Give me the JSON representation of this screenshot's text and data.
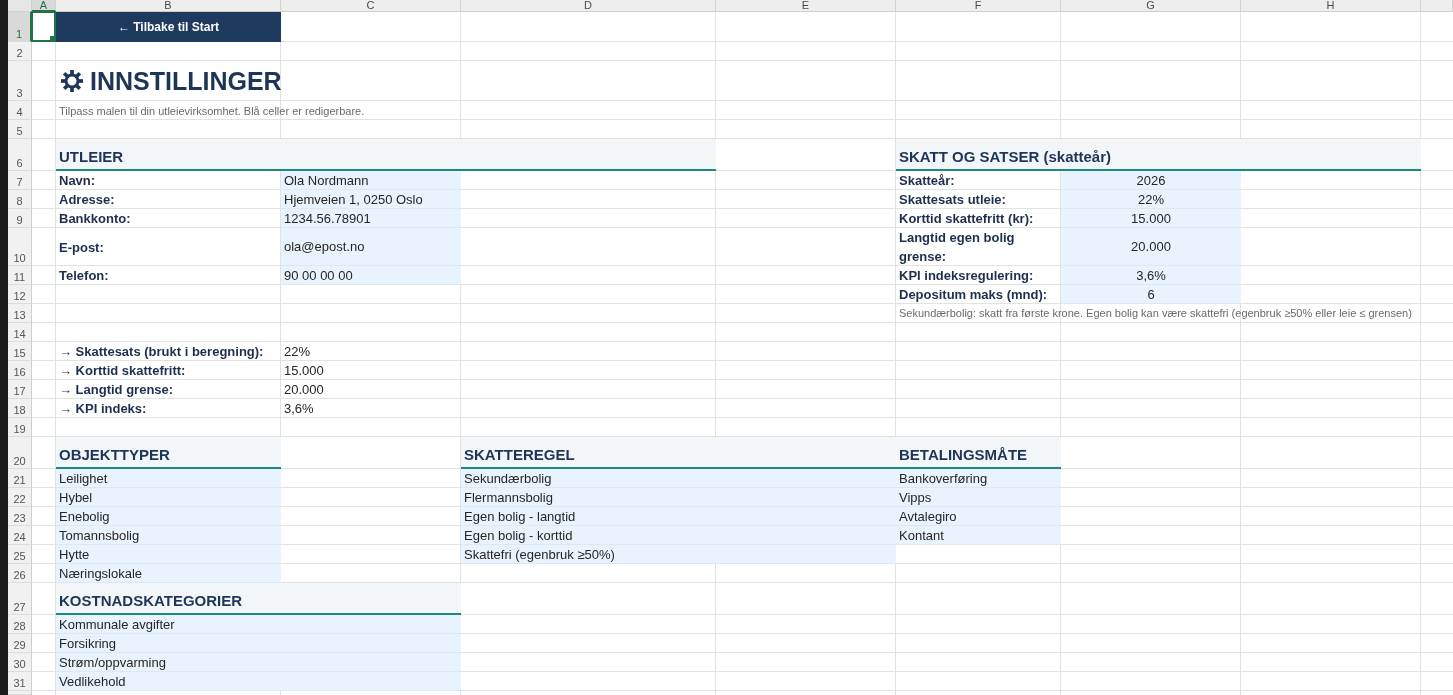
{
  "columns": [
    {
      "label": "A",
      "selected": true
    },
    {
      "label": "B",
      "selected": false
    },
    {
      "label": "C",
      "selected": false
    },
    {
      "label": "D",
      "selected": false
    },
    {
      "label": "E",
      "selected": false
    },
    {
      "label": "F",
      "selected": false
    },
    {
      "label": "G",
      "selected": false
    },
    {
      "label": "H",
      "selected": false
    }
  ],
  "rows": [
    {
      "label": "1",
      "selected": true
    },
    {
      "label": "2",
      "selected": false
    },
    {
      "label": "3",
      "selected": false
    },
    {
      "label": "4",
      "selected": false
    },
    {
      "label": "5",
      "selected": false
    },
    {
      "label": "6",
      "selected": false
    },
    {
      "label": "7",
      "selected": false
    },
    {
      "label": "8",
      "selected": false
    },
    {
      "label": "9",
      "selected": false
    },
    {
      "label": "10",
      "selected": false
    },
    {
      "label": "11",
      "selected": false
    },
    {
      "label": "12",
      "selected": false
    },
    {
      "label": "13",
      "selected": false
    },
    {
      "label": "14",
      "selected": false
    },
    {
      "label": "15",
      "selected": false
    },
    {
      "label": "16",
      "selected": false
    },
    {
      "label": "17",
      "selected": false
    },
    {
      "label": "18",
      "selected": false
    },
    {
      "label": "19",
      "selected": false
    },
    {
      "label": "20",
      "selected": false
    },
    {
      "label": "21",
      "selected": false
    },
    {
      "label": "22",
      "selected": false
    },
    {
      "label": "23",
      "selected": false
    },
    {
      "label": "24",
      "selected": false
    },
    {
      "label": "25",
      "selected": false
    },
    {
      "label": "26",
      "selected": false
    },
    {
      "label": "27",
      "selected": false
    },
    {
      "label": "28",
      "selected": false
    },
    {
      "label": "29",
      "selected": false
    },
    {
      "label": "30",
      "selected": false
    },
    {
      "label": "31",
      "selected": false
    }
  ],
  "back_button": {
    "label": "← Tilbake til Start"
  },
  "title": "INNSTILLINGER",
  "subtitle": "Tilpass malen til din utleievirksomhet. Blå celler er redigerbare.",
  "landlord": {
    "heading": "UTLEIER",
    "fields": [
      {
        "label": "Navn:",
        "value": "Ola Nordmann"
      },
      {
        "label": "Adresse:",
        "value": "Hjemveien 1, 0250 Oslo"
      },
      {
        "label": "Bankkonto:",
        "value": "1234.56.78901"
      },
      {
        "label": "E-post:",
        "value": "ola@epost.no"
      },
      {
        "label": "Telefon:",
        "value": "90 00 00 00"
      }
    ]
  },
  "tax": {
    "heading": "SKATT OG SATSER (skatteår)",
    "fields": [
      {
        "label": "Skatteår:",
        "value": "2026"
      },
      {
        "label": "Skattesats utleie:",
        "value": "22%"
      },
      {
        "label": "Korttid skattefritt (kr):",
        "value": "15.000"
      },
      {
        "label": "Langtid egen bolig grense:",
        "value": "20.000"
      },
      {
        "label": "KPI indeksregulering:",
        "value": "3,6%"
      },
      {
        "label": "Depositum maks (mnd):",
        "value": "6"
      }
    ],
    "note": "Sekundærbolig: skatt fra første krone. Egen bolig kan være skattefri (egenbruk ≥50% eller leie ≤ grensen)"
  },
  "derived": [
    {
      "label": "→ Skattesats (brukt i beregning):",
      "value": "22%"
    },
    {
      "label": "→ Korttid skattefritt:",
      "value": "15.000"
    },
    {
      "label": "→ Langtid grense:",
      "value": "20.000"
    },
    {
      "label": "→ KPI indeks:",
      "value": "3,6%"
    }
  ],
  "lists": [
    {
      "heading": "OBJEKTTYPER",
      "items": [
        "Leilighet",
        "Hybel",
        "Enebolig",
        "Tomannsbolig",
        "Hytte",
        "Næringslokale"
      ]
    },
    {
      "heading": "SKATTEREGEL",
      "items": [
        "Sekundærbolig",
        "Flermannsbolig",
        "Egen bolig - langtid",
        "Egen bolig - korttid",
        "Skattefri (egenbruk ≥50%)"
      ]
    },
    {
      "heading": "BETALINGSMÅTE",
      "items": [
        "Bankoverføring",
        "Vipps",
        "Avtalegiro",
        "Kontant"
      ]
    },
    {
      "heading": "KOSTNADSKATEGORIER",
      "items": [
        "Kommunale avgifter",
        "Forsikring",
        "Strøm/oppvarming",
        "Vedlikehold"
      ]
    }
  ]
}
